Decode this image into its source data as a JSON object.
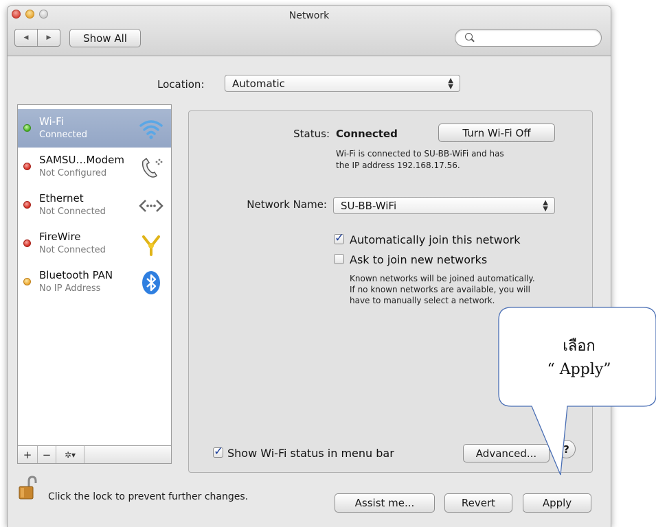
{
  "window": {
    "title": "Network"
  },
  "toolbar": {
    "show_all_label": "Show All",
    "back_glyph": "◀",
    "forward_glyph": "▶"
  },
  "location": {
    "label": "Location:",
    "value": "Automatic"
  },
  "sidebar": {
    "services": [
      {
        "name": "Wi-Fi",
        "status": "Connected",
        "status_color": "green",
        "icon": "wifi-icon",
        "selected": true
      },
      {
        "name": "SAMSU…Modem",
        "status": "Not Configured",
        "status_color": "red",
        "icon": "phone-modem-icon"
      },
      {
        "name": "Ethernet",
        "status": "Not Connected",
        "status_color": "red",
        "icon": "ethernet-icon"
      },
      {
        "name": "FireWire",
        "status": "Not Connected",
        "status_color": "red",
        "icon": "firewire-icon"
      },
      {
        "name": "Bluetooth PAN",
        "status": "No IP Address",
        "status_color": "orange",
        "icon": "bluetooth-icon"
      }
    ],
    "add_glyph": "+",
    "remove_glyph": "−",
    "action_glyph": "✲▾"
  },
  "detail": {
    "status_label": "Status:",
    "status_value": "Connected",
    "turn_off_label": "Turn Wi-Fi Off",
    "status_desc_line1": "Wi-Fi is connected to SU-BB-WiFi and has",
    "status_desc_line2": "the IP address 192.168.17.56.",
    "network_name_label": "Network Name:",
    "network_name_value": "SU-BB-WiFi",
    "auto_join_label": "Automatically join this network",
    "auto_join_checked": true,
    "ask_join_label": "Ask to join new networks",
    "ask_join_checked": false,
    "ask_desc_line1": "Known networks will be joined automatically.",
    "ask_desc_line2": "If no known networks are available, you will",
    "ask_desc_line3": "have to manually select a network.",
    "show_status_label": "Show Wi-Fi status in menu bar",
    "show_status_checked": true,
    "advanced_label": "Advanced...",
    "help_label": "?"
  },
  "footer": {
    "lock_text": "Click the lock to prevent further changes.",
    "assist_label": "Assist me...",
    "revert_label": "Revert",
    "apply_label": "Apply"
  },
  "callout": {
    "line1": "เลือก",
    "line2": "“ Apply”"
  },
  "colors": {
    "selection": "#98aac8",
    "window_bg": "#e8e8e8",
    "callout_fill": "#ffffff",
    "callout_stroke": "#4a6fb5"
  }
}
